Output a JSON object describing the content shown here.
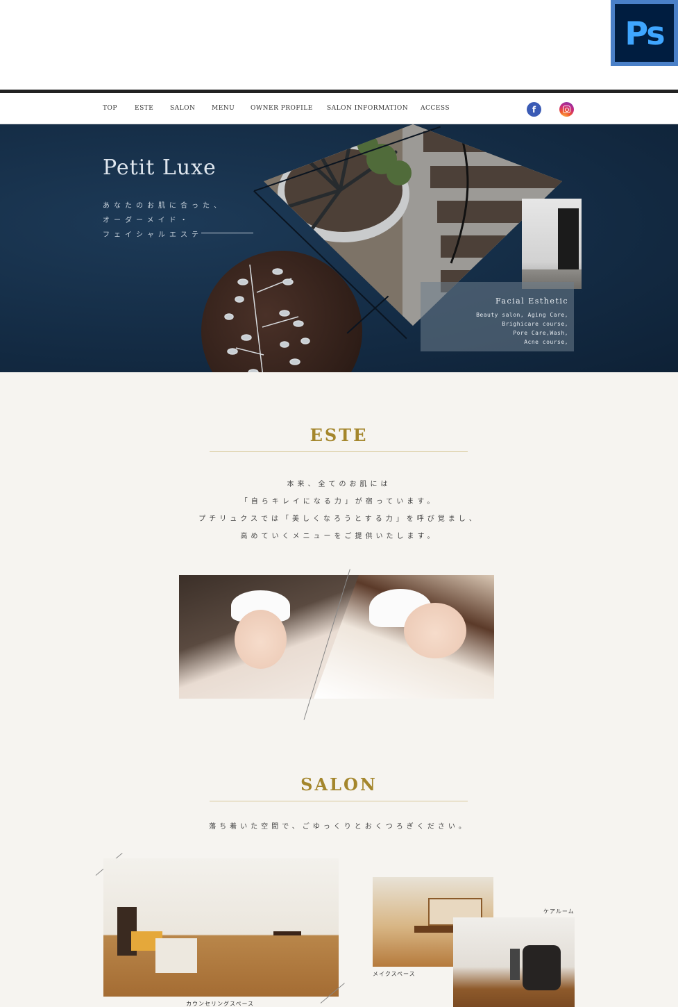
{
  "badge": {
    "label": "Ps"
  },
  "nav": {
    "items": [
      "TOP",
      "ESTE",
      "SALON",
      "MENU",
      "OWNER PROFILE",
      "SALON INFORMATION",
      "ACCESS"
    ],
    "facebook": "f",
    "instagram_icon": "instagram-icon"
  },
  "hero": {
    "title": "Petit Luxe",
    "lines": [
      "あなたのお肌に合った、",
      "オーダーメイド・",
      "フェイシャルエステ"
    ],
    "info_title": "Facial Esthetic",
    "info_lines": [
      "Beauty salon, Aging Care,",
      "Brighicare course,",
      "Pore Care,Wash,",
      "Acne course,"
    ]
  },
  "este": {
    "title": "ESTE",
    "lines": [
      "本来、全てのお肌には",
      "「自らキレイになる力」が宿っています。",
      "プチリュクスでは「美しくなろうとする力」を呼び覚まし、",
      "高めていくメニューをご提供いたします。"
    ]
  },
  "salon": {
    "title": "SALON",
    "lead": "落ち着いた空間で、ごゆっくりとおくつろぎください。",
    "captions": {
      "counseling": "カウンセリングスペース",
      "makeup": "メイクスペース",
      "care": "ケアルーム"
    }
  },
  "colors": {
    "accent": "#a4862c",
    "hero_bg": "#142c45",
    "nav_border": "#222222"
  }
}
